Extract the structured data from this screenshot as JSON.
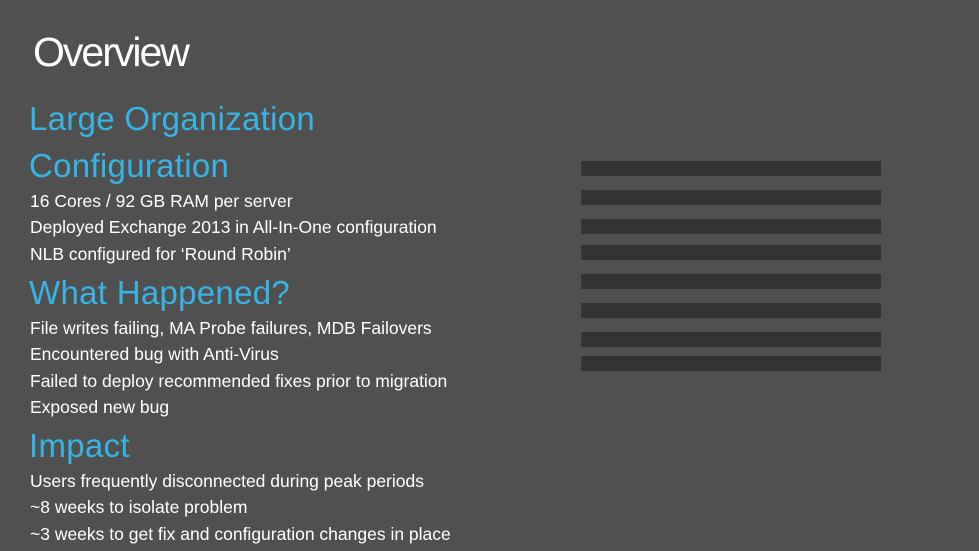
{
  "slide": {
    "title": "Overview",
    "sections": [
      {
        "heading_lines": [
          "Large Organization",
          "Configuration"
        ],
        "bullets": [
          "16 Cores / 92 GB RAM per server",
          "Deployed Exchange 2013 in All-In-One configuration",
          "NLB configured for ‘Round Robin’"
        ]
      },
      {
        "heading_lines": [
          "What Happened?"
        ],
        "bullets": [
          "File writes failing, MA Probe failures, MDB Failovers",
          "Encountered bug with Anti-Virus",
          "Failed to deploy recommended fixes prior to migration",
          "Exposed new bug"
        ]
      },
      {
        "heading_lines": [
          "Impact"
        ],
        "bullets": [
          "Users frequently disconnected during peak periods",
          "~8 weeks to isolate problem",
          "~3 weeks to get fix and configuration changes in place"
        ]
      }
    ],
    "placeholder_bar_count": 8,
    "colors": {
      "background": "#505050",
      "heading": "#37b4e4",
      "text": "#ffffff",
      "bar": "#333333"
    }
  }
}
